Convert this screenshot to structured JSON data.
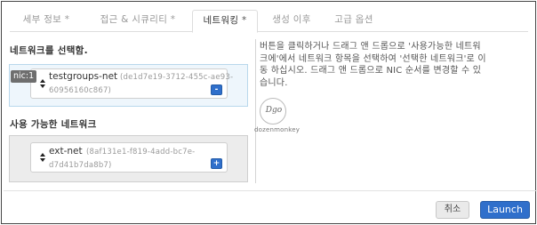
{
  "tabs": [
    {
      "label": "세부 정보",
      "req": "*"
    },
    {
      "label": "접근 & 시큐리티",
      "req": "*"
    },
    {
      "label": "네트워킹",
      "req": "*"
    },
    {
      "label": "생성 이후",
      "req": ""
    },
    {
      "label": "고급 옵션",
      "req": ""
    }
  ],
  "active_tab": "네트워킹",
  "selected_section": {
    "label": "네트워크를 선택함.",
    "networks": [
      {
        "nic": "nic:1",
        "name": "testgroups-net",
        "id_line1": "(de1d7e19-3712-455c-ae93-",
        "id_line2": "60956160c867)",
        "action": "-"
      }
    ]
  },
  "available_section": {
    "label": "사용 가능한 네트워크",
    "networks": [
      {
        "name": "ext-net",
        "id_line1": "(8af131e1-f819-4add-bc7e-",
        "id_line2": "d7d41b7da8b7)",
        "action": "+"
      }
    ]
  },
  "help_text": {
    "line1": "버튼을 클릭하거나 드래그 앤 드롭으로 '사용가능한 네트워",
    "line2": "크에'에서 네트워크 항목을 선택하여 '선택한 네트워크'로 이",
    "line3": "동 하십시오. 드래그 앤 드롭으로 NIC 순서를 변경할 수 있",
    "line4": "습니다."
  },
  "watermark": {
    "logo_text": "Dgo",
    "caption": "dozenmonkey"
  },
  "footer": {
    "cancel_label": "취소",
    "launch_label": "Launch"
  },
  "colors": {
    "primary": "#2f6fcb",
    "selected_bg": "#eef6fc",
    "available_bg": "#ececec"
  }
}
